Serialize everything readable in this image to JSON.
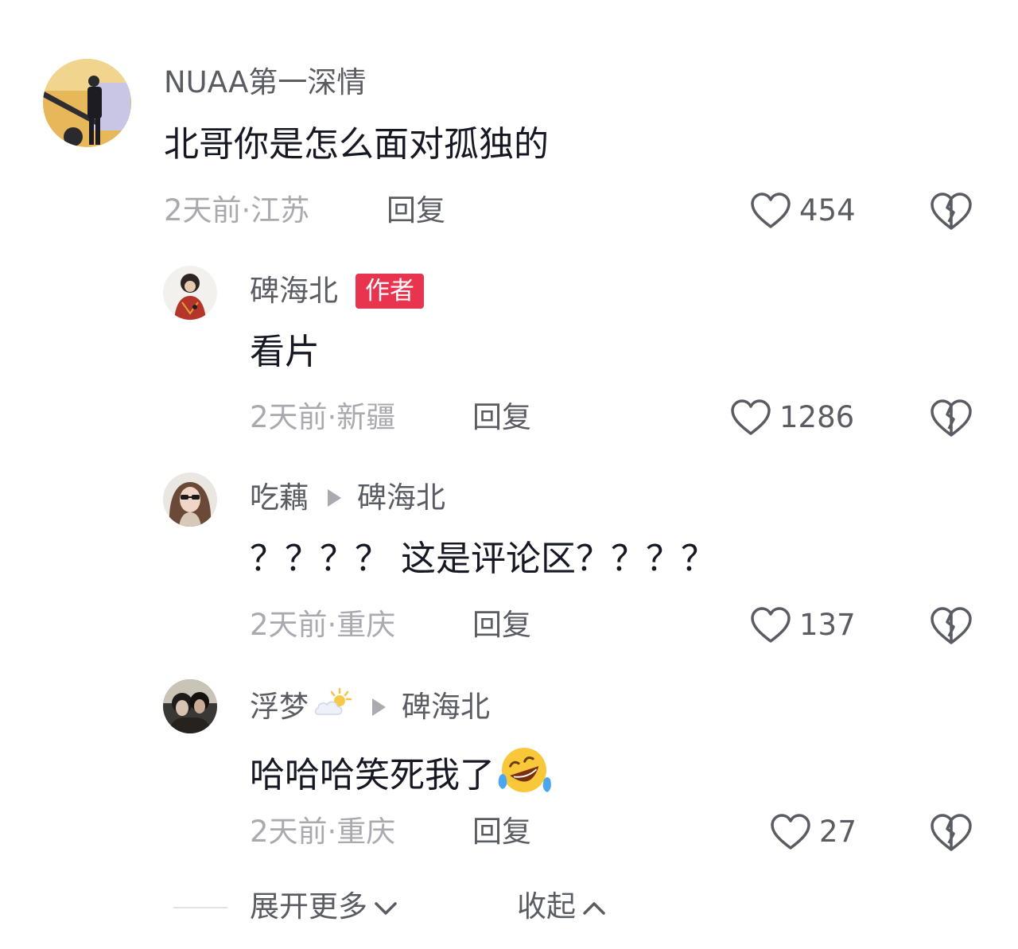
{
  "comment": {
    "username": "NUAA第一深情",
    "text": "北哥你是怎么面对孤独的",
    "time_location": "2天前·江苏",
    "reply_label": "回复",
    "likes": "454"
  },
  "replies": [
    {
      "username": "碑海北",
      "badge": "作者",
      "text": "看片",
      "time_location": "2天前·新疆",
      "reply_label": "回复",
      "likes": "1286"
    },
    {
      "username": "吃藕",
      "reply_to": "碑海北",
      "text": "？？？？ 这是评论区？？？？",
      "time_location": "2天前·重庆",
      "reply_label": "回复",
      "likes": "137"
    },
    {
      "username": "浮梦",
      "username_emoji": "partly-sunny-emoji",
      "reply_to": "碑海北",
      "text": "哈哈哈笑死我了",
      "text_emoji": "rolling-laughing-emoji",
      "time_location": "2天前·重庆",
      "reply_label": "回复",
      "likes": "27"
    }
  ],
  "footer": {
    "expand_label": "展开更多",
    "collapse_label": "收起"
  },
  "colors": {
    "badge": "#e8344e",
    "primary_text": "#161823",
    "secondary_text": "#5a5c63",
    "meta_text": "#a9aab0"
  }
}
